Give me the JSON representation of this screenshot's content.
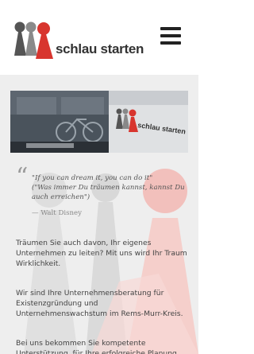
{
  "header": {
    "logo_text": "schlau starten"
  },
  "hero": {
    "sign_text": "schlau starten"
  },
  "quote": {
    "en": "\"If you can dream it, you can do it\"",
    "de": "(\"Was immer Du träumen kannst, kannst Du auch erreichen\")",
    "author": "— Walt Disney"
  },
  "content": {
    "p1": "Träumen Sie auch davon, Ihr eigenes Unternehmen zu leiten? Mit uns wird Ihr Traum Wirklichkeit.",
    "p2": "Wir sind Ihre Unternehmensberatung für Existenzgründung und Unternehmenswachstum im Rems-Murr-Kreis.",
    "p3": "Bei uns bekommen Sie kompetente Unterstützung, für Ihre erfolgreiche Planung"
  },
  "colors": {
    "red": "#d8352e",
    "grey": "#7b7b7b",
    "dark": "#333333",
    "background": "#eeeeee"
  }
}
